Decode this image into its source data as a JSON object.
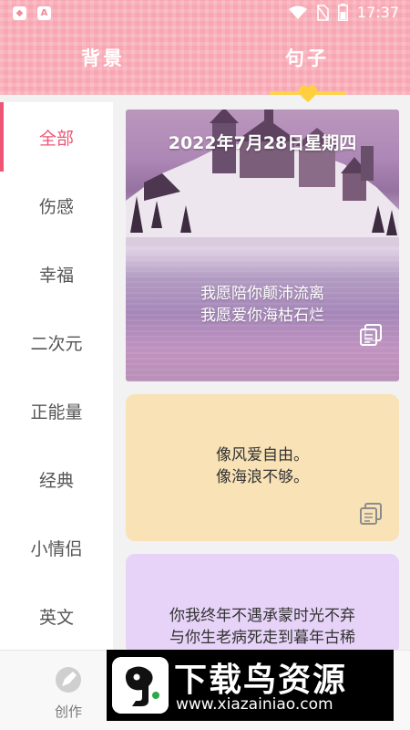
{
  "status_bar": {
    "time": "17:37",
    "left_icons": [
      "shield-icon",
      "a-icon"
    ],
    "right_icons": [
      "wifi-icon",
      "no-sim-icon",
      "battery-icon"
    ]
  },
  "tabs": [
    {
      "label": "背景",
      "active": false
    },
    {
      "label": "句子",
      "active": true
    }
  ],
  "categories": [
    {
      "label": "全部",
      "active": true
    },
    {
      "label": "伤感",
      "active": false
    },
    {
      "label": "幸福",
      "active": false
    },
    {
      "label": "二次元",
      "active": false
    },
    {
      "label": "正能量",
      "active": false
    },
    {
      "label": "经典",
      "active": false
    },
    {
      "label": "小情侣",
      "active": false
    },
    {
      "label": "英文",
      "active": false
    }
  ],
  "cards": [
    {
      "type": "photo",
      "date": "2022年7月28日星期四",
      "lines": [
        "我愿陪你颠沛流离",
        "我愿爱你海枯石烂"
      ],
      "action_icon": "copy-icon"
    },
    {
      "type": "color",
      "background": "#f8e2b6",
      "lines": [
        "像风爱自由。",
        "像海浪不够。"
      ],
      "action_icon": "copy-icon"
    },
    {
      "type": "color",
      "background": "#e6d3f7",
      "lines": [
        "你我终年不遇承蒙时光不弃",
        "与你生老病死走到暮年古稀"
      ]
    }
  ],
  "bottom_nav": {
    "create_label": "创作",
    "create_icon": "create-icon"
  },
  "watermark": {
    "title": "下载鸟资源",
    "url": "www.xiazainiao.com"
  },
  "colors": {
    "header_pink": "#f7a6b2",
    "accent": "#ee5575",
    "underline": "#ffd24d"
  }
}
